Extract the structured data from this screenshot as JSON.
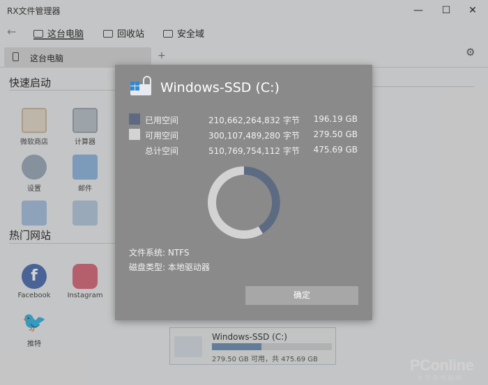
{
  "app": {
    "title": "RX文件管理器",
    "window_controls": {
      "minimize": "—",
      "maximize": "☐",
      "close": "✕"
    },
    "nav": {
      "back_icon": "←",
      "tabs": [
        {
          "label": "这台电脑",
          "active": true
        },
        {
          "label": "回收站",
          "active": false
        },
        {
          "label": "安全域",
          "active": false
        }
      ],
      "settings_icon": "⚙"
    },
    "doc_tab": {
      "label": "这台电脑",
      "add": "+"
    }
  },
  "quick_launch": {
    "title": "快速启动",
    "items": [
      {
        "label": "微软商店",
        "icon": "store-icon"
      },
      {
        "label": "计算器",
        "icon": "calculator-icon"
      },
      {
        "label": "设置",
        "icon": "settings-icon"
      },
      {
        "label": "邮件",
        "icon": "mail-icon"
      },
      {
        "label": "",
        "icon": "calendar-icon"
      },
      {
        "label": "",
        "icon": "photos-icon"
      }
    ]
  },
  "hot_sites": {
    "title": "热门网站",
    "items": [
      {
        "label": "Facebook",
        "icon": "facebook-icon",
        "glyph": "f"
      },
      {
        "label": "Instagram",
        "icon": "instagram-icon"
      },
      {
        "label": "推特",
        "icon": "twitter-icon",
        "glyph": "🐦"
      }
    ]
  },
  "drive_card": {
    "name": "Windows-SSD (C:)",
    "usage_fraction": 0.4125,
    "info": "279.50 GB 可用，共 475.69 GB"
  },
  "watermark": {
    "main": "PConline",
    "sub": "太平洋电脑网"
  },
  "dialog": {
    "title": "Windows-SSD (C:)",
    "used": {
      "label": "已用空间",
      "bytes": "210,662,264,832 字节",
      "human": "196.19 GB",
      "color": "#5d6b82"
    },
    "free": {
      "label": "可用空间",
      "bytes": "300,107,489,280 字节",
      "human": "279.50 GB",
      "color": "#d3d3d3"
    },
    "total": {
      "label": "总计空间",
      "bytes": "510,769,754,112 字节",
      "human": "475.69 GB"
    },
    "used_fraction": 0.4125,
    "filesystem": "文件系统: NTFS",
    "disk_type": "磁盘类型: 本地驱动器",
    "ok_label": "确定"
  }
}
